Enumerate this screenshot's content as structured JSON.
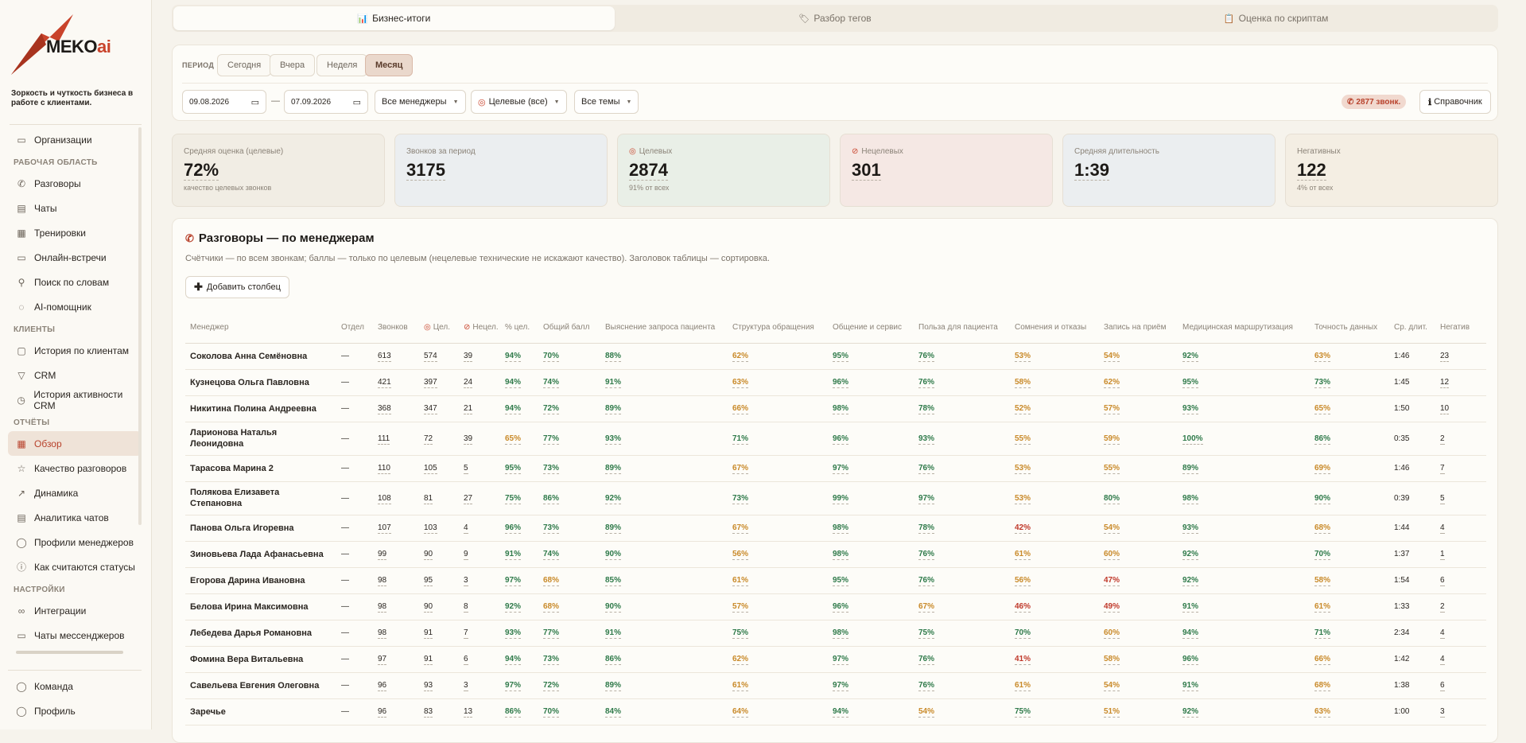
{
  "sidebar": {
    "brand": "MEKO",
    "brand_accent": "ai",
    "tagline": "Зоркость и чуткость бизнеса в работе с клиентами.",
    "top_items": [
      {
        "label": "Организации",
        "icon": "folder-icon"
      }
    ],
    "sections": [
      {
        "title": "РАБОЧАЯ ОБЛАСТЬ",
        "items": [
          {
            "label": "Разговоры",
            "icon": "phone-icon"
          },
          {
            "label": "Чаты",
            "icon": "chat-icon"
          },
          {
            "label": "Тренировки",
            "icon": "training-icon"
          },
          {
            "label": "Онлайн-встречи",
            "icon": "video-icon"
          },
          {
            "label": "Поиск по словам",
            "icon": "search-icon"
          },
          {
            "label": "AI-помощник",
            "icon": "ai-icon"
          }
        ]
      },
      {
        "title": "КЛИЕНТЫ",
        "items": [
          {
            "label": "История по клиентам",
            "icon": "history-icon"
          },
          {
            "label": "CRM",
            "icon": "filter-icon"
          },
          {
            "label": "История активности CRM",
            "icon": "activity-icon"
          }
        ]
      },
      {
        "title": "ОТЧЁТЫ",
        "items": [
          {
            "label": "Обзор",
            "icon": "grid-icon",
            "active": true
          },
          {
            "label": "Качество разговоров",
            "icon": "star-icon"
          },
          {
            "label": "Динамика",
            "icon": "trend-icon"
          },
          {
            "label": "Аналитика чатов",
            "icon": "chat-analytics-icon"
          },
          {
            "label": "Профили менеджеров",
            "icon": "profile-icon"
          },
          {
            "label": "Как считаются статусы",
            "icon": "help-icon"
          }
        ]
      },
      {
        "title": "НАСТРОЙКИ",
        "items": [
          {
            "label": "Интеграции",
            "icon": "link-icon"
          },
          {
            "label": "Чаты мессенджеров",
            "icon": "messenger-icon"
          }
        ]
      }
    ],
    "bottom_items": [
      {
        "label": "Команда",
        "icon": "team-icon"
      },
      {
        "label": "Профиль",
        "icon": "user-icon"
      }
    ]
  },
  "tabs": [
    {
      "label": "Бизнес-итоги",
      "icon": "📊",
      "active": true
    },
    {
      "label": "Разбор тегов",
      "icon": "🏷"
    },
    {
      "label": "Оценка по скриптам",
      "icon": "📋"
    }
  ],
  "filters": {
    "period_label": "ПЕРИОД",
    "period_buttons": [
      "Сегодня",
      "Вчера",
      "Неделя",
      "Месяц"
    ],
    "active_period": "Месяц",
    "date_from": "09.08.2026",
    "date_sep": "—",
    "date_to": "07.09.2026",
    "managers": "Все менеджеры",
    "target": "Целевые (все)",
    "topics": "Все темы",
    "calls_badge": "2877 звонк.",
    "reference": "Справочник"
  },
  "kpis": [
    {
      "label": "Средняя оценка (целевые)",
      "value": "72%",
      "sub": "качество целевых звонков"
    },
    {
      "label": "Звонков за период",
      "value": "3175",
      "sub": ""
    },
    {
      "label": "Целевых",
      "value": "2874",
      "sub": "91% от всех",
      "icon": "target-icon"
    },
    {
      "label": "Нецелевых",
      "value": "301",
      "sub": "",
      "icon": "no-icon"
    },
    {
      "label": "Средняя длительность",
      "value": "1:39",
      "sub": ""
    },
    {
      "label": "Негативных",
      "value": "122",
      "sub": "4% от всех"
    }
  ],
  "panel": {
    "title": "Разговоры — по менеджерам",
    "desc": "Счётчики — по всем звонкам; баллы — только по целевым (нецелевые технические не искажают качество). Заголовок таблицы — сортировка.",
    "add_column": "Добавить столбец",
    "headers": [
      "Менеджер",
      "Отдел",
      "Звонков",
      "Цел.",
      "Нецел.",
      "% цел.",
      "Общий балл",
      "Выяснение запроса пациента",
      "Структура обращения",
      "Общение и сервис",
      "Польза для пациента",
      "Сомнения и отказы",
      "Запись на приём",
      "Медицинская маршрутизация",
      "Точность данных",
      "Ср. длит.",
      "Негатив"
    ],
    "rows": [
      [
        "Соколова Анна Семёновна",
        "—",
        "613",
        "574",
        "39",
        "94%",
        "70%",
        "88%",
        "62%",
        "95%",
        "76%",
        "53%",
        "54%",
        "92%",
        "63%",
        "1:46",
        "23"
      ],
      [
        "Кузнецова Ольга Павловна",
        "—",
        "421",
        "397",
        "24",
        "94%",
        "74%",
        "91%",
        "63%",
        "96%",
        "76%",
        "58%",
        "62%",
        "95%",
        "73%",
        "1:45",
        "12"
      ],
      [
        "Никитина Полина Андреевна",
        "—",
        "368",
        "347",
        "21",
        "94%",
        "72%",
        "89%",
        "66%",
        "98%",
        "78%",
        "52%",
        "57%",
        "93%",
        "65%",
        "1:50",
        "10"
      ],
      [
        "Ларионова Наталья Леонидовна",
        "—",
        "111",
        "72",
        "39",
        "65%",
        "77%",
        "93%",
        "71%",
        "96%",
        "93%",
        "55%",
        "59%",
        "100%",
        "86%",
        "0:35",
        "2"
      ],
      [
        "Тарасова Марина 2",
        "—",
        "110",
        "105",
        "5",
        "95%",
        "73%",
        "89%",
        "67%",
        "97%",
        "76%",
        "53%",
        "55%",
        "89%",
        "69%",
        "1:46",
        "7"
      ],
      [
        "Полякова Елизавета Степановна",
        "—",
        "108",
        "81",
        "27",
        "75%",
        "86%",
        "92%",
        "73%",
        "99%",
        "97%",
        "53%",
        "80%",
        "98%",
        "90%",
        "0:39",
        "5"
      ],
      [
        "Панова Ольга Игоревна",
        "—",
        "107",
        "103",
        "4",
        "96%",
        "73%",
        "89%",
        "67%",
        "98%",
        "78%",
        "42%",
        "54%",
        "93%",
        "68%",
        "1:44",
        "4"
      ],
      [
        "Зиновьева Лада Афанасьевна",
        "—",
        "99",
        "90",
        "9",
        "91%",
        "74%",
        "90%",
        "56%",
        "98%",
        "76%",
        "61%",
        "60%",
        "92%",
        "70%",
        "1:37",
        "1"
      ],
      [
        "Егорова Дарина Ивановна",
        "—",
        "98",
        "95",
        "3",
        "97%",
        "68%",
        "85%",
        "61%",
        "95%",
        "76%",
        "56%",
        "47%",
        "92%",
        "58%",
        "1:54",
        "6"
      ],
      [
        "Белова Ирина Максимовна",
        "—",
        "98",
        "90",
        "8",
        "92%",
        "68%",
        "90%",
        "57%",
        "96%",
        "67%",
        "46%",
        "49%",
        "91%",
        "61%",
        "1:33",
        "2"
      ],
      [
        "Лебедева Дарья Романовна",
        "—",
        "98",
        "91",
        "7",
        "93%",
        "77%",
        "91%",
        "75%",
        "98%",
        "75%",
        "70%",
        "60%",
        "94%",
        "71%",
        "2:34",
        "4"
      ],
      [
        "Фомина Вера Витальевна",
        "—",
        "97",
        "91",
        "6",
        "94%",
        "73%",
        "86%",
        "62%",
        "97%",
        "76%",
        "41%",
        "58%",
        "96%",
        "66%",
        "1:42",
        "4"
      ],
      [
        "Савельева Евгения Олеговна",
        "—",
        "96",
        "93",
        "3",
        "97%",
        "72%",
        "89%",
        "61%",
        "97%",
        "76%",
        "61%",
        "54%",
        "91%",
        "68%",
        "1:38",
        "6"
      ],
      [
        "Заречье",
        "—",
        "96",
        "83",
        "13",
        "86%",
        "70%",
        "84%",
        "64%",
        "94%",
        "54%",
        "75%",
        "51%",
        "92%",
        "63%",
        "1:00",
        "3"
      ]
    ]
  },
  "colors": {
    "accent": "#b8422c",
    "good": "#2f7a4a",
    "mid": "#c98a2a",
    "bad": "#c0392b"
  }
}
